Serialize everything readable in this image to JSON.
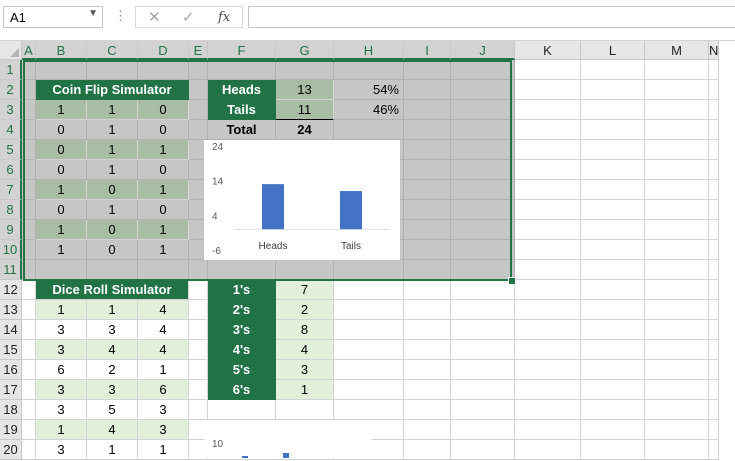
{
  "formula_bar": {
    "name_box": "A1",
    "formula": "",
    "fx_label": "fx",
    "cancel_icon": "x-icon",
    "enter_icon": "check-icon"
  },
  "columns": [
    "A",
    "B",
    "C",
    "D",
    "E",
    "F",
    "G",
    "H",
    "I",
    "J",
    "K",
    "L",
    "M",
    "N"
  ],
  "rows": [
    "1",
    "2",
    "3",
    "4",
    "5",
    "6",
    "7",
    "8",
    "9",
    "10",
    "11",
    "12",
    "13",
    "14",
    "15",
    "16",
    "17",
    "18",
    "19",
    "20"
  ],
  "coin": {
    "title": "Coin Flip Simulator",
    "flips": [
      [
        "1",
        "1",
        "0"
      ],
      [
        "0",
        "1",
        "0"
      ],
      [
        "0",
        "1",
        "1"
      ],
      [
        "0",
        "1",
        "0"
      ],
      [
        "1",
        "0",
        "1"
      ],
      [
        "0",
        "1",
        "0"
      ],
      [
        "1",
        "0",
        "1"
      ],
      [
        "1",
        "0",
        "1"
      ]
    ],
    "heads_label": "Heads",
    "tails_label": "Tails",
    "total_label": "Total",
    "heads_count": "13",
    "tails_count": "11",
    "total_count": "24",
    "heads_pct": "54%",
    "tails_pct": "46%"
  },
  "dice": {
    "title": "Dice Roll Simulator",
    "rolls": [
      [
        "1",
        "1",
        "4"
      ],
      [
        "3",
        "3",
        "4"
      ],
      [
        "3",
        "4",
        "4"
      ],
      [
        "6",
        "2",
        "1"
      ],
      [
        "3",
        "3",
        "6"
      ],
      [
        "3",
        "5",
        "3"
      ],
      [
        "1",
        "4",
        "3"
      ],
      [
        "3",
        "1",
        "1"
      ]
    ],
    "faces": [
      "1's",
      "2's",
      "3's",
      "4's",
      "5's",
      "6's"
    ],
    "counts": [
      "7",
      "2",
      "8",
      "4",
      "3",
      "1"
    ]
  },
  "chart_data": [
    {
      "type": "bar",
      "categories": [
        "Heads",
        "Tails"
      ],
      "values": [
        13,
        11
      ],
      "title": "",
      "xlabel": "",
      "ylabel": "",
      "ylim": [
        -6,
        24
      ],
      "yticks": [
        "24",
        "14",
        "4",
        "-6"
      ],
      "bar_color": "#4472c4"
    },
    {
      "type": "bar",
      "partially_visible": true,
      "ytick_visible": "10",
      "bar_color": "#4472c4"
    }
  ]
}
